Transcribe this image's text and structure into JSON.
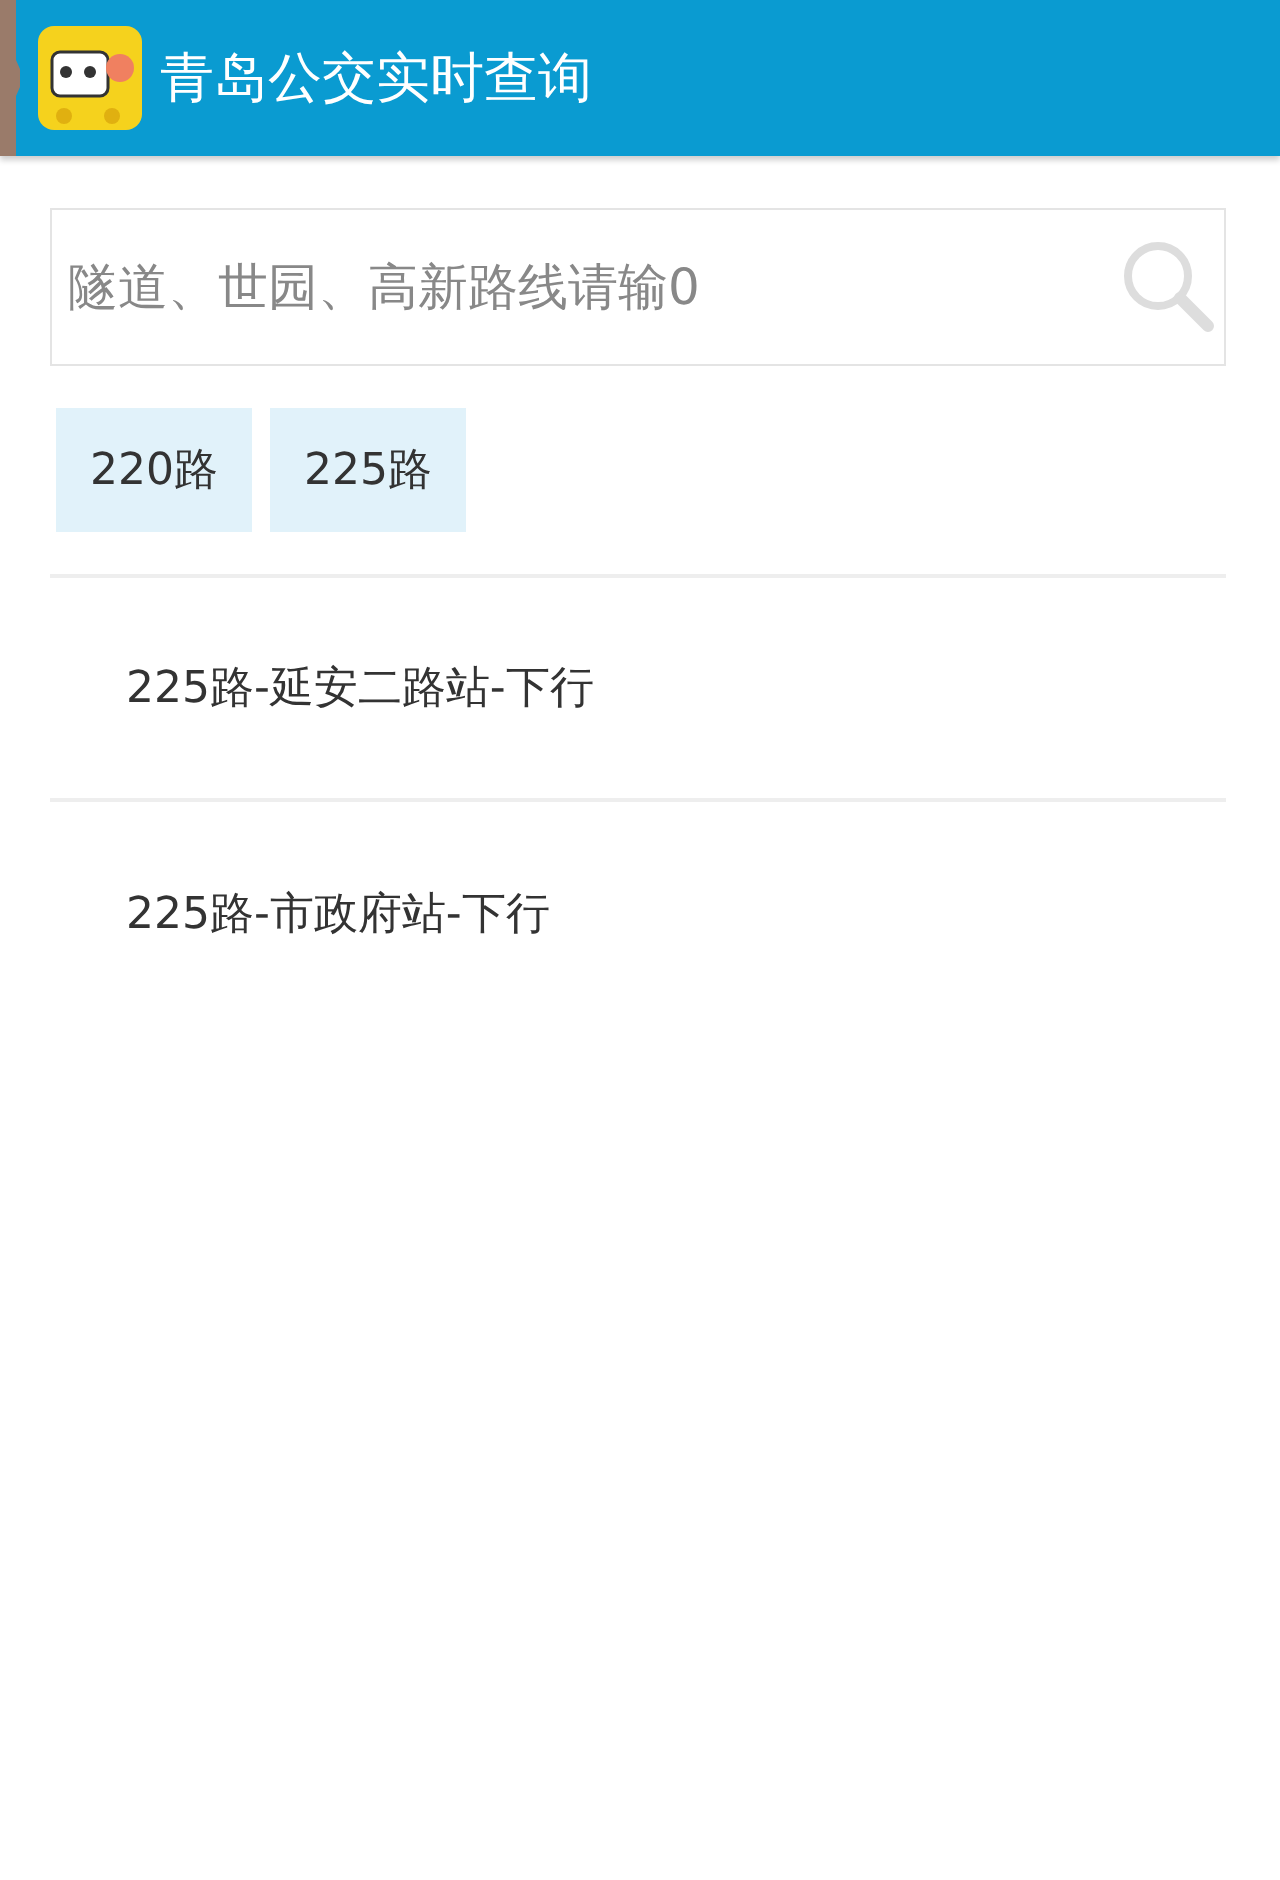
{
  "app_bar": {
    "title": "青岛公交实时查询"
  },
  "search": {
    "placeholder": "隧道、世园、高新路线请输0"
  },
  "history_chips": [
    "220路",
    "225路"
  ],
  "results": [
    {
      "label": "225路-延安二路站-下行"
    },
    {
      "label": "225路-市政府站-下行"
    }
  ]
}
